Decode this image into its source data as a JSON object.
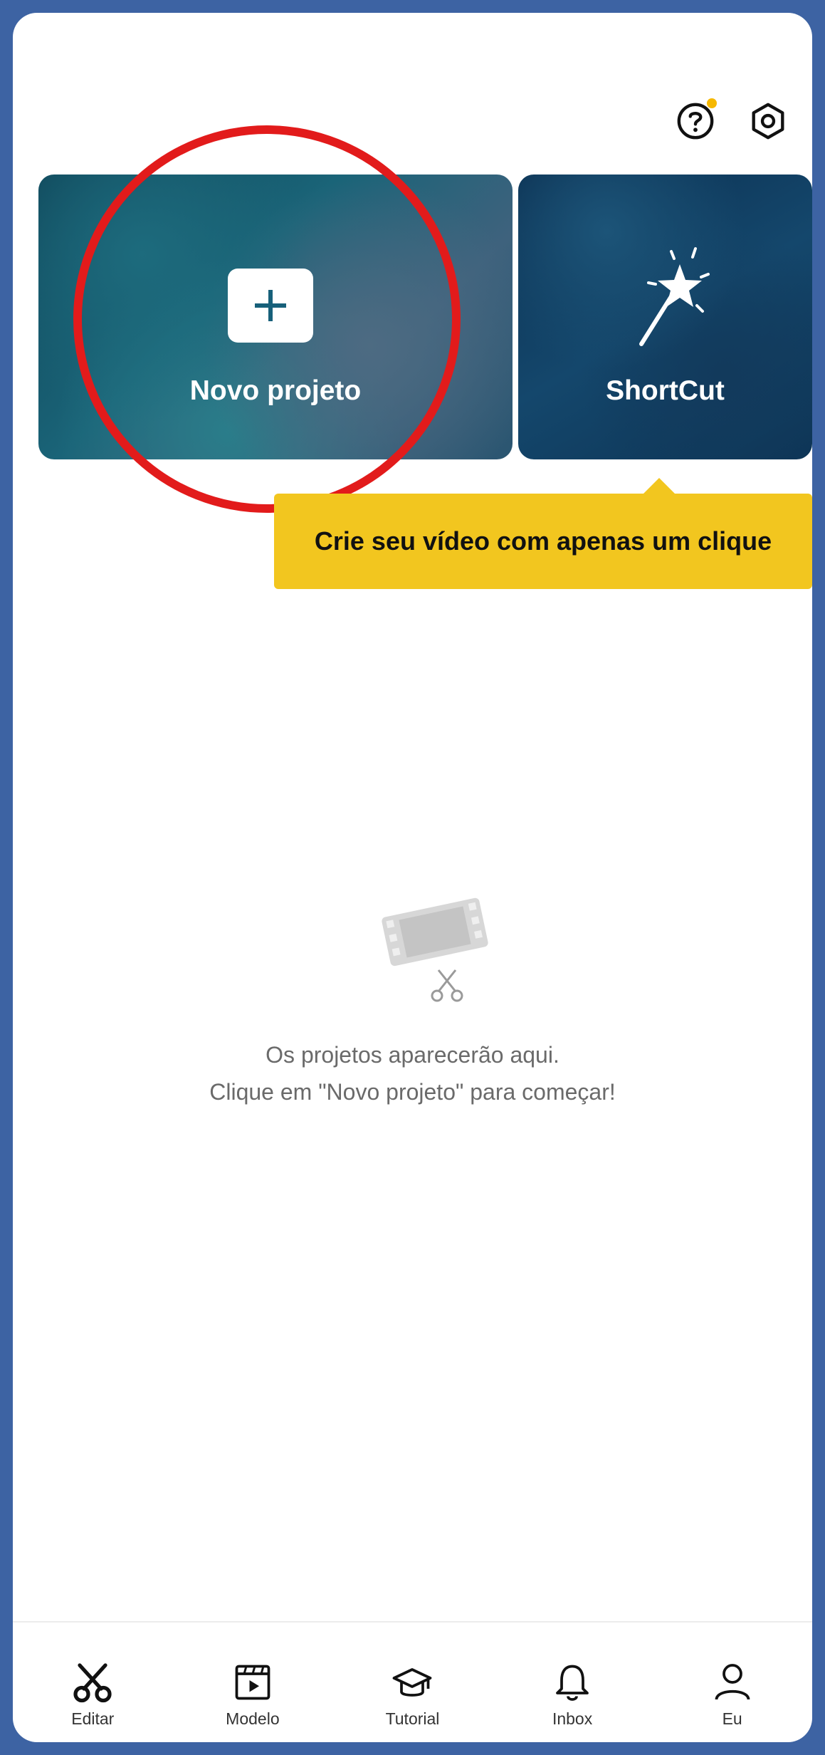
{
  "header": {
    "help_icon": "question-circle-icon",
    "settings_icon": "hexagon-gear-icon",
    "help_dot_color": "#f6b800"
  },
  "cards": {
    "new_project_label": "Novo projeto",
    "shortcut_label": "ShortCut"
  },
  "tooltip": {
    "text": "Crie seu vídeo com apenas um clique",
    "color": "#f2c61f"
  },
  "empty_state": {
    "line1": "Os projetos aparecerão aqui.",
    "line2": "Clique em \"Novo projeto\" para começar!"
  },
  "nav": {
    "items": [
      {
        "label": "Editar",
        "icon": "scissors-icon"
      },
      {
        "label": "Modelo",
        "icon": "clapperboard-icon"
      },
      {
        "label": "Tutorial",
        "icon": "graduation-cap-icon"
      },
      {
        "label": "Inbox",
        "icon": "bell-icon"
      },
      {
        "label": "Eu",
        "icon": "user-icon"
      }
    ]
  },
  "colors": {
    "background": "#3d63a3",
    "highlight_ring": "#e21b1b"
  }
}
